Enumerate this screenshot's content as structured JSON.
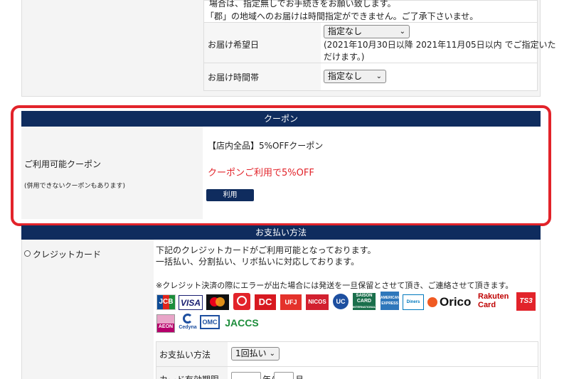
{
  "delivery": {
    "note_line1": "場合は、指定無しでお手続きをお願い致します。",
    "note_line2": "「郡」の地域へのお届けは時間指定ができません。ご了承下さいませ。",
    "date_label": "お届け希望日",
    "date_value": "指定なし",
    "date_note_line1": "(2021年10月30日以降 2021年11月05日以内 でご指定いた",
    "date_note_line2": "だけます。)",
    "time_label": "お届け時間帯",
    "time_value": "指定なし"
  },
  "coupon": {
    "header": "クーポン",
    "label": "ご利用可能クーポン",
    "sublabel": "(併用できないクーポンもあります)",
    "coupon_name": "【店内全品】5%OFFクーポン",
    "applied_text": "クーポンご利用で5%OFF",
    "use_button": "利用"
  },
  "payment": {
    "header": "お支払い方法",
    "option_label": "クレジットカード",
    "desc_line1": "下記のクレジットカードがご利用可能となっております。",
    "desc_line2": "一括払い、分割払い、リボ払いに対応しております。",
    "desc_line3": "※クレジット決済の際にエラーが出た場合には発送を一旦保留とさせて頂き、ご連絡させて頂きます。",
    "cards": {
      "jcb": "JCB",
      "visa": "VISA",
      "mastercard": "mastercard",
      "saison_top": "SAISON",
      "saison_mid": "CARD",
      "saison_bot": "INTERNATIONAL",
      "dc": "DC",
      "ufj": "UFJ",
      "nicos": "NICOS",
      "uc": "UC",
      "amex": "AMERICAN EXPRESS",
      "diners": "Diners Club",
      "orico": "Orico",
      "rakuten_top": "Rakuten",
      "rakuten_bot": "Card",
      "ts3": "TS3",
      "aeon": "AEON",
      "cedyna": "Cedyna",
      "omc": "OMC",
      "jaccs": "JACCS"
    },
    "method_label": "お支払い方法",
    "method_value": "1回払い",
    "expiry_label": "カード有効期限",
    "expiry_year_suffix": "年/",
    "expiry_month_suffix": "月"
  }
}
